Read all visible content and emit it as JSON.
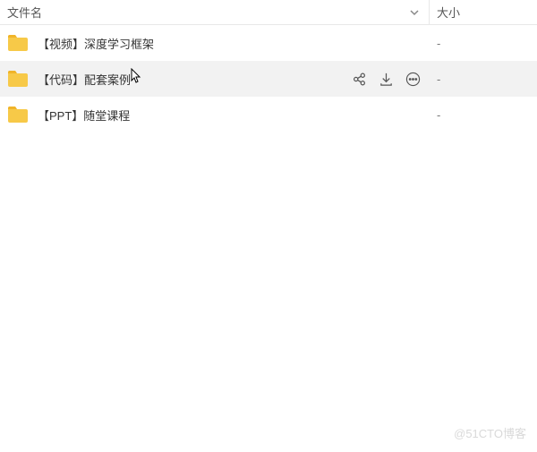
{
  "header": {
    "name_label": "文件名",
    "size_label": "大小"
  },
  "files": [
    {
      "name": "【视频】深度学习框架",
      "size": "-",
      "hovered": false,
      "show_actions": false
    },
    {
      "name": "【代码】配套案例",
      "size": "-",
      "hovered": true,
      "show_actions": true
    },
    {
      "name": "【PPT】随堂课程",
      "size": "-",
      "hovered": false,
      "show_actions": false
    }
  ],
  "icons": {
    "folder_color": "#f7c948",
    "folder_tab_color": "#f0b429"
  },
  "watermark": "@51CTO博客"
}
